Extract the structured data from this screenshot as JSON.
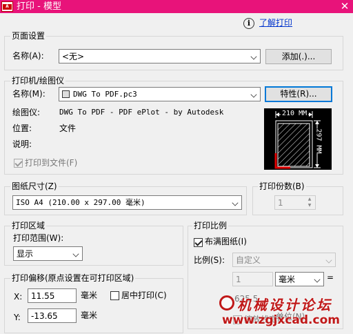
{
  "window": {
    "title": "打印 - 模型",
    "close_glyph": "✕",
    "app_icon_text": "A"
  },
  "help": {
    "link": "了解打印",
    "info_glyph": "i"
  },
  "page_setup": {
    "title": "页面设置",
    "name_label": "名称(A):",
    "name_value": "<无>",
    "add_button": "添加(.)..."
  },
  "printer": {
    "title": "打印机/绘图仪",
    "name_label": "名称(M):",
    "name_value": "DWG To PDF.pc3",
    "properties_button": "特性(R)...",
    "plotter_label": "绘图仪:",
    "plotter_value": "DWG To PDF - PDF ePlot - by Autodesk",
    "location_label": "位置:",
    "location_value": "文件",
    "description_label": "说明:",
    "print_to_file_label": "打印到文件(F)",
    "print_to_file_checked": true,
    "preview": {
      "width_label": "210 MM",
      "height_label": "297 MM"
    }
  },
  "paper_size": {
    "title": "图纸尺寸(Z)",
    "value": "ISO A4 (210.00 x 297.00 毫米)"
  },
  "copies": {
    "title": "打印份数(B)",
    "value": "1"
  },
  "plot_area": {
    "title": "打印区域",
    "range_label": "打印范围(W):",
    "range_value": "显示"
  },
  "plot_offset": {
    "title": "打印偏移(原点设置在可打印区域)",
    "x_label": "X:",
    "x_value": "11.55",
    "x_unit": "毫米",
    "y_label": "Y:",
    "y_value": "-13.65",
    "y_unit": "毫米",
    "center_label": "居中打印(C)",
    "center_checked": false
  },
  "plot_scale": {
    "title": "打印比例",
    "fit_label": "布满图纸(I)",
    "fit_checked": true,
    "scale_label": "比例(S):",
    "scale_value": "自定义",
    "value1": "1",
    "unit_value": "毫米",
    "equals": "=",
    "value2": "625.5",
    "unit2_label": "单位(N)",
    "lineweight_label": "缩放线宽(L)"
  },
  "watermark": {
    "text": "机械设计论坛",
    "url": "www.zgjxcad.com"
  },
  "colors": {
    "titlebar": "#e8137a",
    "focus_border": "#0078d7",
    "link": "#0033cc",
    "preview_red": "#e00000"
  }
}
